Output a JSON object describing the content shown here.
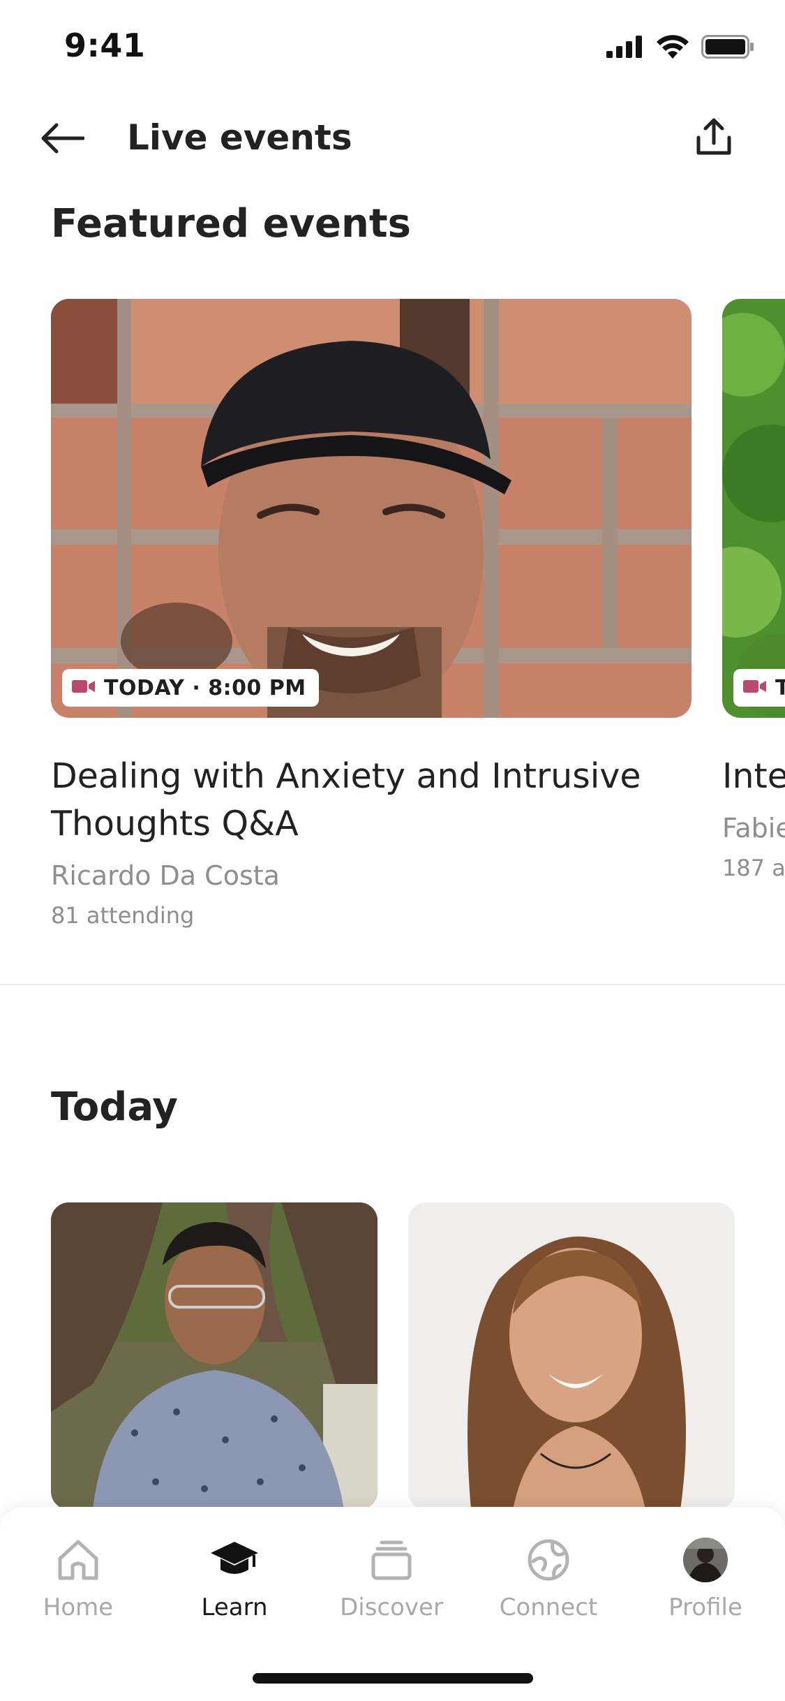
{
  "status_bar": {
    "time": "9:41",
    "icons": [
      "cellular-signal-icon",
      "wifi-icon",
      "battery-icon"
    ]
  },
  "header": {
    "title": "Live events",
    "back_icon": "arrow-left-icon",
    "share_icon": "share-upload-icon"
  },
  "featured": {
    "title": "Featured events",
    "cards": [
      {
        "badge": "TODAY · 8:00 PM",
        "badge_icon": "video-camera-icon",
        "title": "Dealing with Anxiety and Intrusive Thoughts Q&A",
        "host": "Ricardo Da Costa",
        "attending": "81 attending"
      },
      {
        "badge": "T",
        "badge_icon": "video-camera-icon",
        "title": "Inte",
        "host": "Fabie",
        "attending": "187 at"
      }
    ]
  },
  "today": {
    "title": "Today"
  },
  "tab_bar": {
    "tabs": [
      {
        "label": "Home",
        "icon": "home-icon",
        "active": false
      },
      {
        "label": "Learn",
        "icon": "graduation-cap-icon",
        "active": true
      },
      {
        "label": "Discover",
        "icon": "stack-cards-icon",
        "active": false
      },
      {
        "label": "Connect",
        "icon": "globe-icon",
        "active": false
      },
      {
        "label": "Profile",
        "icon": "avatar-icon",
        "active": false
      }
    ]
  },
  "colors": {
    "accent_badge": "#b8496f",
    "text_primary": "#222222",
    "text_secondary": "#8e8e8e"
  }
}
